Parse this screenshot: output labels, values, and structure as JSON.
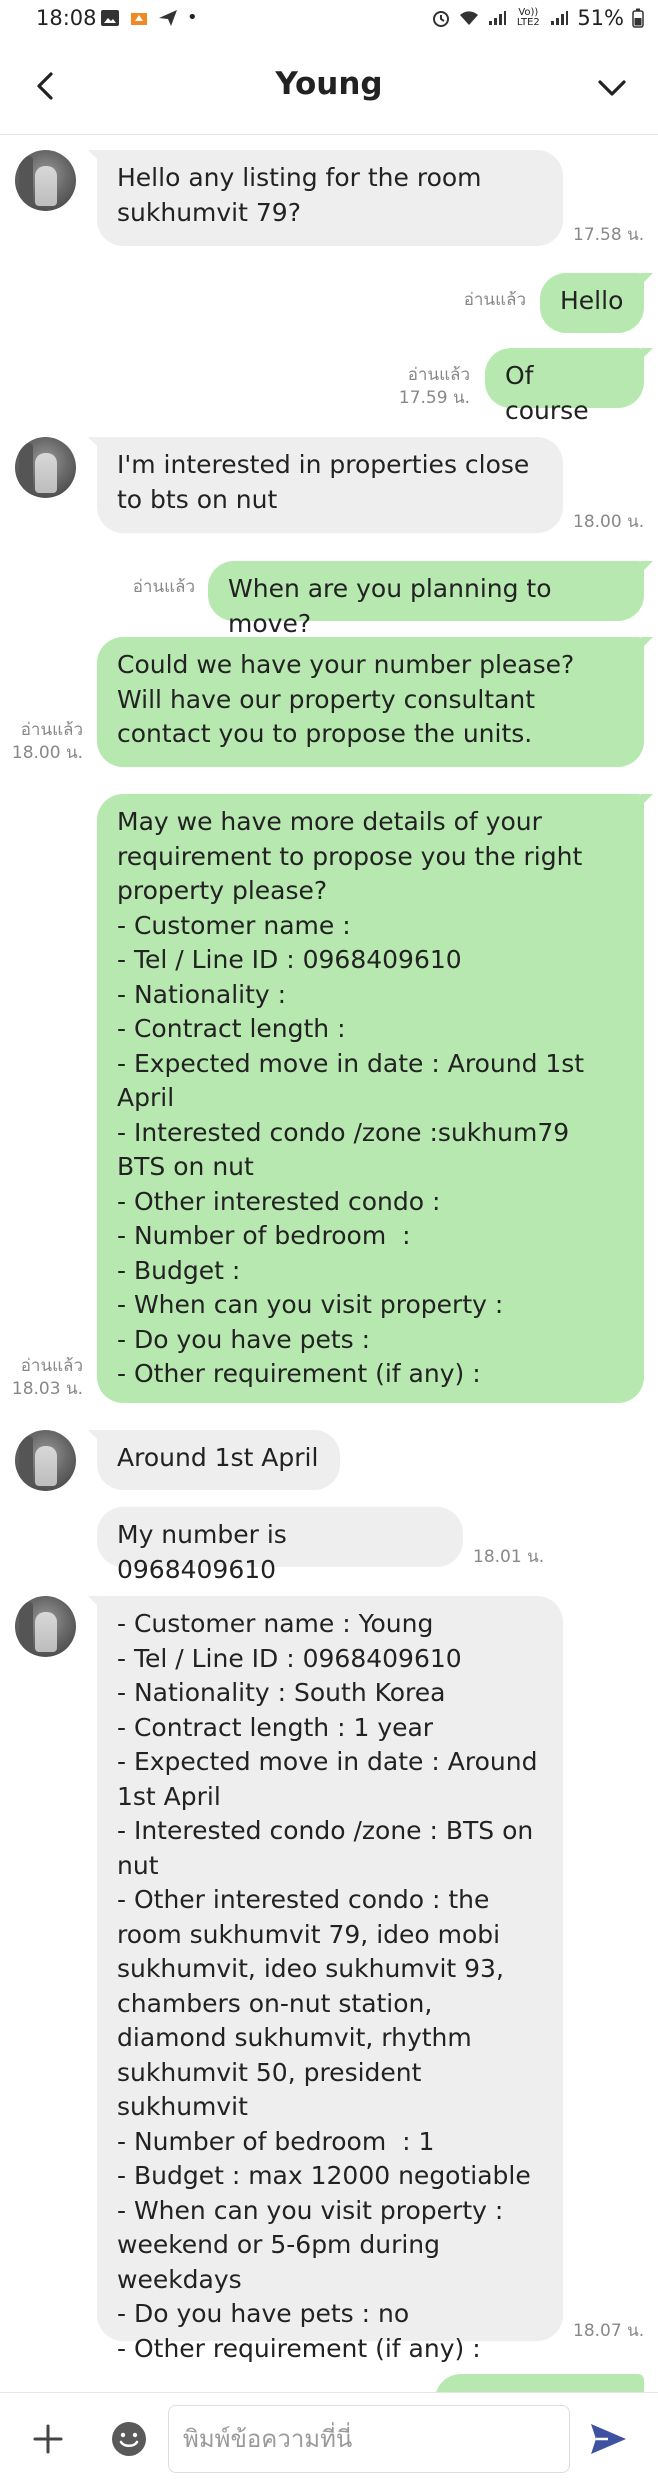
{
  "status_bar": {
    "time": "18:08",
    "dot": "•",
    "battery": "51%",
    "network_badge": "Vo)) LTE2",
    "icons": [
      "image-icon",
      "favorite-app-icon",
      "send-icon",
      "alarm-icon",
      "wifi-icon",
      "signal-icon",
      "signal-icon",
      "battery-icon"
    ]
  },
  "header": {
    "title": "Young",
    "back_icon": "chevron-left-icon",
    "menu_icon": "chevron-down-icon"
  },
  "chat": {
    "messages": [
      {
        "id": "m1",
        "sender": "contact",
        "text": "Hello any listing for the room sukhumvit 79?",
        "time": "17.58 น."
      },
      {
        "id": "m2",
        "sender": "me",
        "text": "Hello",
        "read": "อ่านแล้ว"
      },
      {
        "id": "m3",
        "sender": "me",
        "text": "Of course",
        "read": "อ่านแล้ว",
        "time": "17.59 น."
      },
      {
        "id": "m4",
        "sender": "contact",
        "text": "I'm interested in properties close to bts on nut",
        "time": "18.00 น."
      },
      {
        "id": "m5",
        "sender": "me",
        "text": "When are you planning to move?",
        "read": "อ่านแล้ว"
      },
      {
        "id": "m6",
        "sender": "me",
        "text": "Could we have your number please? Will have our property consultant contact you to propose the units.",
        "read": "อ่านแล้ว",
        "time": "18.00 น."
      },
      {
        "id": "m7",
        "sender": "me",
        "text": "May we have more details of your requirement to propose you the right property please?\n- Customer name :\n- Tel / Line ID : 0968409610\n- Nationality :\n- Contract length :\n- Expected move in date : Around 1st April\n- Interested condo /zone :sukhum79 BTS on nut\n- Other interested condo :\n- Number of bedroom  :\n- Budget :\n- When can you visit property :\n- Do you have pets :\n- Other requirement (if any) :",
        "read": "อ่านแล้ว",
        "time": "18.03 น."
      },
      {
        "id": "m8",
        "sender": "contact",
        "text": "Around 1st April"
      },
      {
        "id": "m9",
        "sender": "contact",
        "text": "My number is 0968409610",
        "time": "18.01 น."
      },
      {
        "id": "m10",
        "sender": "contact",
        "text": "- Customer name : Young\n- Tel / Line ID : 0968409610\n- Nationality : South Korea\n- Contract length : 1 year\n- Expected move in date : Around 1st April\n- Interested condo /zone : BTS on nut\n- Other interested condo : the room sukhumvit 79, ideo mobi sukhumvit, ideo sukhumvit 93, chambers on-nut station, diamond sukhumvit, rhythm sukhumvit 50, president sukhumvit\n- Number of bedroom  : 1\n- Budget : max 12000 negotiable\n- When can you visit property : weekend or 5-6pm during weekdays\n- Do you have pets : no\n- Other requirement (if any) :",
        "time": "18.07 น."
      }
    ]
  },
  "input_bar": {
    "placeholder": "พิมพ์ข้อความที่นี่",
    "value": "",
    "icons": [
      "plus-icon",
      "emoji-icon",
      "send-icon"
    ]
  },
  "colors": {
    "outgoing_bubble": "#b7e8b0",
    "incoming_bubble": "#eeeeef",
    "send_icon": "#3d52a0",
    "meta_text": "#888888"
  }
}
